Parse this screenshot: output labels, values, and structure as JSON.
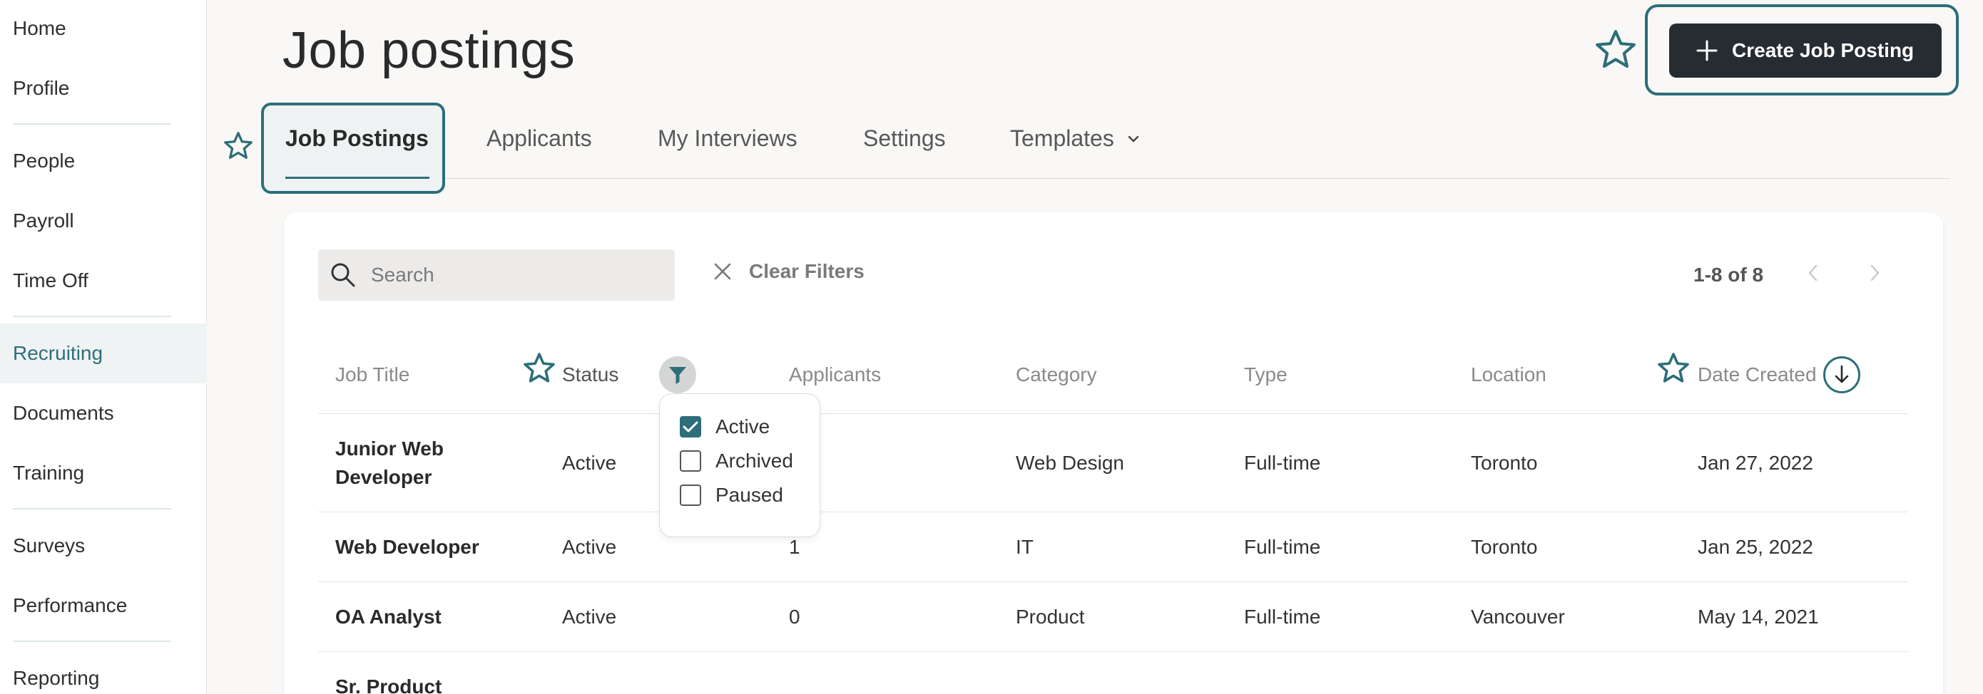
{
  "sidebar": {
    "items": [
      {
        "label": "Home"
      },
      {
        "label": "Profile"
      },
      {
        "label": "People"
      },
      {
        "label": "Payroll"
      },
      {
        "label": "Time Off"
      },
      {
        "label": "Recruiting"
      },
      {
        "label": "Documents"
      },
      {
        "label": "Training"
      },
      {
        "label": "Surveys"
      },
      {
        "label": "Performance"
      },
      {
        "label": "Reporting"
      }
    ],
    "active_item": "Recruiting"
  },
  "header": {
    "title": "Job postings",
    "create_button_label": "Create Job Posting"
  },
  "tabs": [
    {
      "label": "Job Postings",
      "active": true
    },
    {
      "label": "Applicants"
    },
    {
      "label": "My Interviews"
    },
    {
      "label": "Settings"
    },
    {
      "label": "Templates"
    }
  ],
  "toolbar": {
    "search_placeholder": "Search",
    "clear_filters_label": "Clear Filters",
    "pagination_text": "1-8 of 8"
  },
  "table": {
    "columns": [
      "Job Title",
      "Status",
      "Applicants",
      "Category",
      "Type",
      "Location",
      "Date Created"
    ],
    "rows": [
      {
        "title_line1": "Junior Web",
        "title_line2": "Developer",
        "status": "Active",
        "applicants": "",
        "category": "Web Design",
        "type": "Full-time",
        "location": "Toronto",
        "date": "Jan 27, 2022"
      },
      {
        "title_line1": "Web Developer",
        "title_line2": "",
        "status": "Active",
        "applicants": "1",
        "category": "IT",
        "type": "Full-time",
        "location": "Toronto",
        "date": "Jan 25, 2022"
      },
      {
        "title_line1": "OA Analyst",
        "title_line2": "",
        "status": "Active",
        "applicants": "0",
        "category": "Product",
        "type": "Full-time",
        "location": "Vancouver",
        "date": "May 14, 2021"
      },
      {
        "title_line1": "Sr. Product",
        "title_line2": "",
        "status": "",
        "applicants": "",
        "category": "",
        "type": "",
        "location": "",
        "date": ""
      }
    ]
  },
  "status_filter": {
    "options": [
      {
        "label": "Active",
        "checked": true
      },
      {
        "label": "Archived",
        "checked": false
      },
      {
        "label": "Paused",
        "checked": false
      }
    ]
  },
  "colors": {
    "accent": "#2d6e7a",
    "button_dark": "#252d32",
    "background": "#f9f8f6"
  }
}
